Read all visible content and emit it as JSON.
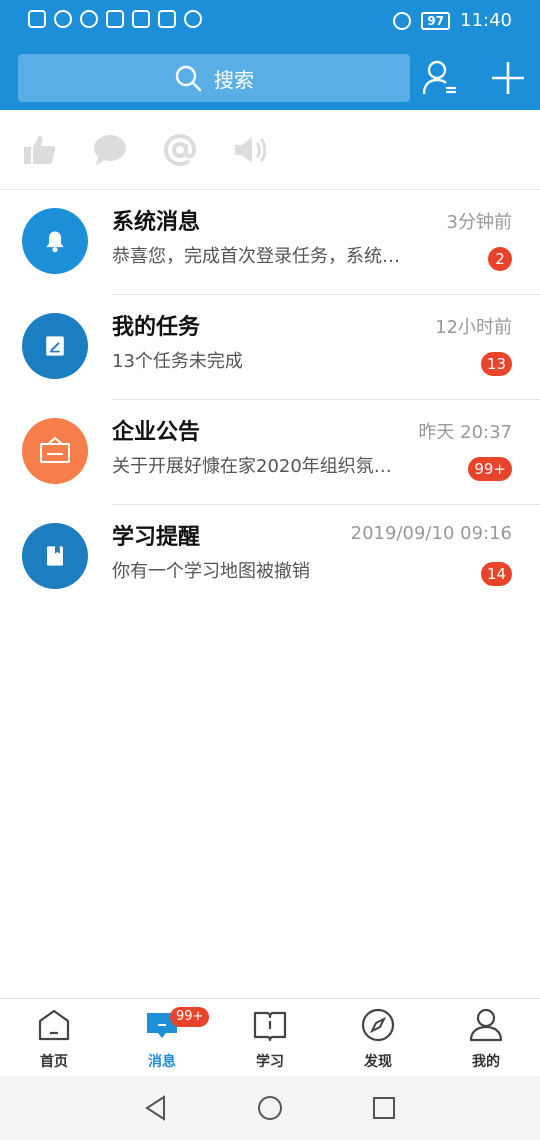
{
  "status_bar": {
    "time": "11:40",
    "battery": "97"
  },
  "search": {
    "label": "搜索"
  },
  "colors": {
    "primary": "#1d8fd8",
    "badge": "#e8432b",
    "orange": "#f57e4b"
  },
  "quick_actions": [
    {
      "icon": "thumbs-up-icon"
    },
    {
      "icon": "comment-icon"
    },
    {
      "icon": "at-icon"
    },
    {
      "icon": "speaker-icon"
    }
  ],
  "messages": [
    {
      "title": "系统消息",
      "time": "3分钟前",
      "preview": "恭喜您，完成首次登录任务，系统…",
      "badge": "2",
      "icon": "bell-icon"
    },
    {
      "title": "我的任务",
      "time": "12小时前",
      "preview": "13个任务未完成",
      "badge": "13",
      "icon": "task-icon"
    },
    {
      "title": "企业公告",
      "time": "昨天 20:37",
      "preview": "关于开展好慷在家2020年组织氛…",
      "badge": "99+",
      "icon": "announcement-icon"
    },
    {
      "title": "学习提醒",
      "time": "2019/09/10 09:16",
      "preview": "你有一个学习地图被撤销",
      "badge": "14",
      "icon": "book-icon"
    }
  ],
  "nav": [
    {
      "label": "首页",
      "icon": "home-icon"
    },
    {
      "label": "消息",
      "icon": "message-icon",
      "badge": "99+",
      "active": true
    },
    {
      "label": "学习",
      "icon": "study-book-icon"
    },
    {
      "label": "发现",
      "icon": "compass-icon"
    },
    {
      "label": "我的",
      "icon": "profile-icon"
    }
  ]
}
